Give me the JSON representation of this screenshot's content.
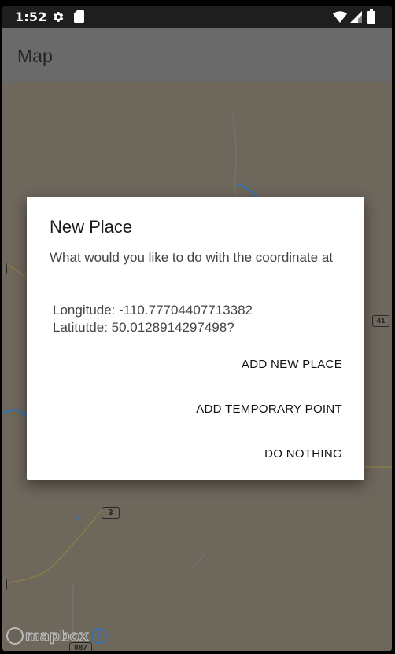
{
  "status_bar": {
    "time": "1:52",
    "icons": [
      "gear-icon",
      "sd-card-icon",
      "wifi-icon",
      "cell-signal-icon",
      "battery-icon"
    ]
  },
  "toolbar": {
    "title": "Map"
  },
  "map": {
    "shields": [
      "41",
      "3",
      "887"
    ],
    "attribution": "mapbox",
    "info_icon": "info-icon"
  },
  "dialog": {
    "title": "New Place",
    "message": "What would you like to do with the coordinate at",
    "longitude_line": "Longitude: -110.77704407713382",
    "latitude_line": "Latitutde: 50.0128914297498?",
    "buttons": {
      "add_new_place": "ADD NEW PLACE",
      "add_temporary_point": "ADD TEMPORARY POINT",
      "do_nothing": "DO NOTHING"
    }
  },
  "colors": {
    "status_bar": "#1e1e1e",
    "toolbar_dimmed": "#6a6a6a",
    "map_dimmed": "#6e675c",
    "dialog_bg": "#ffffff",
    "water": "#3a6fa8",
    "road": "#8a7d48"
  }
}
